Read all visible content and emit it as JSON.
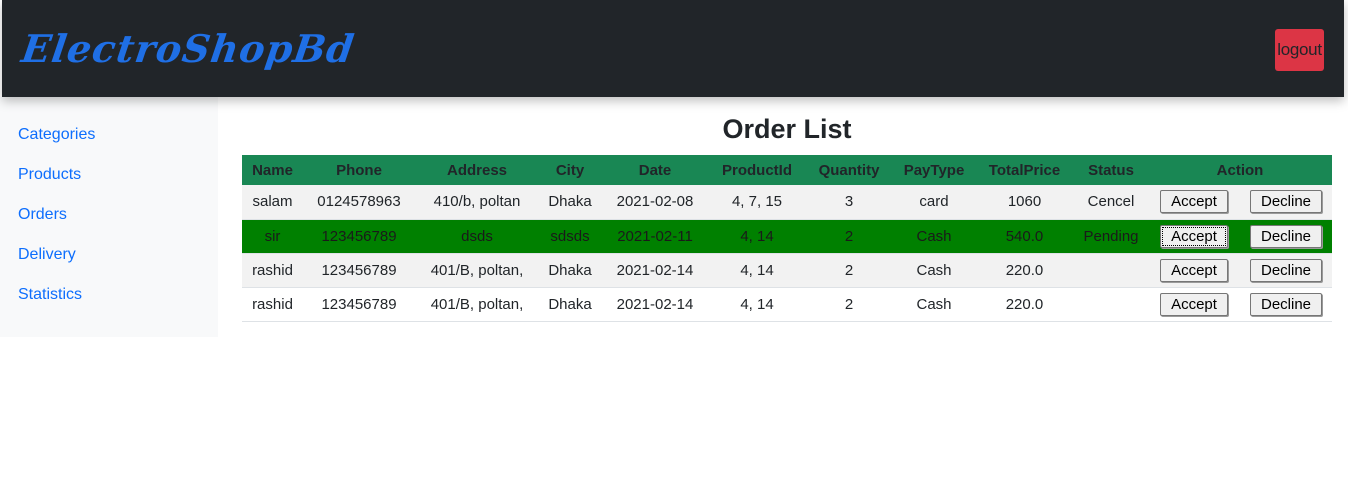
{
  "brand": {
    "name": "ElectroShopBd"
  },
  "header": {
    "logout_label": "logout"
  },
  "sidebar": {
    "items": [
      {
        "label": "Categories"
      },
      {
        "label": "Products"
      },
      {
        "label": "Orders"
      },
      {
        "label": "Delivery"
      },
      {
        "label": "Statistics"
      }
    ]
  },
  "main": {
    "title": "Order List",
    "columns": [
      "Name",
      "Phone",
      "Address",
      "City",
      "Date",
      "ProductId",
      "Quantity",
      "PayType",
      "TotalPrice",
      "Status",
      "Action"
    ],
    "accept_label": "Accept",
    "decline_label": "Decline",
    "rows": [
      {
        "name": "salam",
        "phone": "0124578963",
        "address": "410/b, poltan",
        "city": "Dhaka",
        "date": "2021-02-08",
        "product_id": "4, 7, 15",
        "quantity": "3",
        "pay_type": "card",
        "total_price": "1060",
        "status": "Cencel"
      },
      {
        "name": "sir",
        "phone": "123456789",
        "address": "dsds",
        "city": "sdsds",
        "date": "2021-02-11",
        "product_id": "4, 14",
        "quantity": "2",
        "pay_type": "Cash",
        "total_price": "540.0",
        "status": "Pending"
      },
      {
        "name": "rashid",
        "phone": "123456789",
        "address": "401/B, poltan,",
        "city": "Dhaka",
        "date": "2021-02-14",
        "product_id": "4, 14",
        "quantity": "2",
        "pay_type": "Cash",
        "total_price": "220.0",
        "status": ""
      },
      {
        "name": "rashid",
        "phone": "123456789",
        "address": "401/B, poltan,",
        "city": "Dhaka",
        "date": "2021-02-14",
        "product_id": "4, 14",
        "quantity": "2",
        "pay_type": "Cash",
        "total_price": "220.0",
        "status": ""
      }
    ]
  },
  "colors": {
    "navbar": "#212529",
    "brand": "#1f6fe5",
    "logout": "#dc3545",
    "table_header": "#198754",
    "highlight_row": "#008000",
    "link": "#0d6efd"
  }
}
